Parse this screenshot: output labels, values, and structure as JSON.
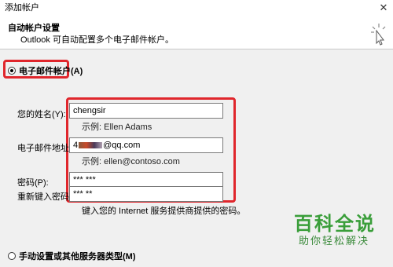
{
  "window": {
    "title": "添加帐户",
    "close_glyph": "✕"
  },
  "header": {
    "title": "自动帐户设置",
    "subtitle": "Outlook 可自动配置多个电子邮件帐户。"
  },
  "options": {
    "email_account": "电子邮件帐户(A)",
    "manual_setup": "手动设置或其他服务器类型(M)"
  },
  "form": {
    "name_label": "您的姓名(Y):",
    "name_value": "chengsir",
    "name_example": "示例: Ellen Adams",
    "email_label": "电子邮件地址(E):",
    "email_prefix": "4",
    "email_suffix": "@qq.com",
    "email_example": "示例: ellen@contoso.com",
    "password_label": "密码(P):",
    "password_value": "***     ***",
    "retype_label": "重新键入密码(T):",
    "retype_value": "***     **",
    "password_hint": "键入您的 Internet 服务提供商提供的密码。"
  },
  "watermark": {
    "line1": "百科全说",
    "line2": "助你轻松解决"
  },
  "colors": {
    "highlight_box": "#e0262c",
    "watermark": "#3a9e3a"
  }
}
